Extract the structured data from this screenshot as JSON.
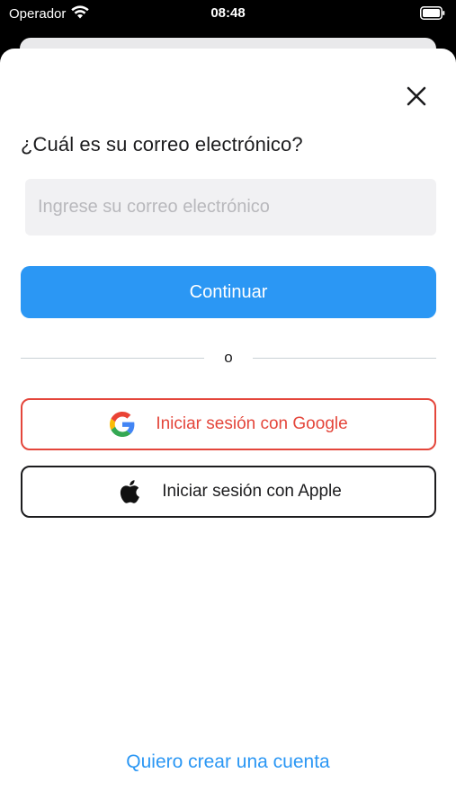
{
  "status_bar": {
    "carrier": "Operador",
    "time": "08:48"
  },
  "login_sheet": {
    "title": "¿Cuál es su correo electrónico?",
    "email_placeholder": "Ingrese su correo electrónico",
    "email_value": "",
    "continue_label": "Continuar",
    "divider_text": "o",
    "google_label": "Iniciar sesión con Google",
    "apple_label": "Iniciar sesión con Apple",
    "create_account_label": "Quiero crear una cuenta"
  },
  "icons": {
    "close": "close-icon",
    "google": "google-logo-icon",
    "apple": "apple-logo-icon",
    "wifi": "wifi-icon",
    "battery": "battery-icon"
  },
  "colors": {
    "primary": "#2b97f4",
    "google_red": "#e4463b",
    "text_dark": "#1c1c1e",
    "input_bg": "#f1f1f3"
  }
}
